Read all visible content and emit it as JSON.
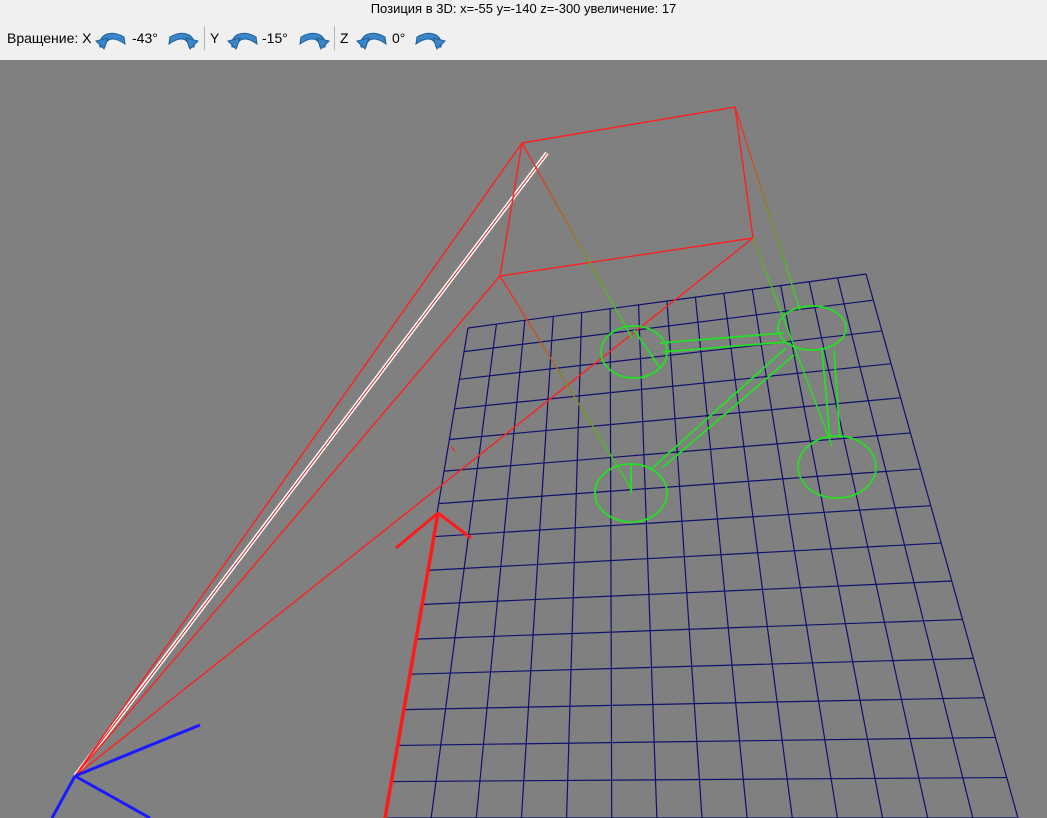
{
  "window": {
    "title": "Позиция в 3D: x=-55 y=-140 z=-300 увеличение: 17"
  },
  "toolbar": {
    "rotation_label": "Вращение: X",
    "x": {
      "axis_label": "X",
      "value": "-43°"
    },
    "y": {
      "axis_label": "Y",
      "value": "-15°"
    },
    "z": {
      "axis_label": "Z",
      "value": "0°"
    },
    "icons": {
      "rotate_left": "rotate-left-icon",
      "rotate_right": "rotate-right-icon"
    }
  },
  "colors": {
    "viewport_background": "#808080",
    "grid": "#10106e",
    "frustum": "#ff2020",
    "model": "#22e022",
    "axis_red": "#ff1a1a",
    "axis_blue": "#1a1aff",
    "ray": "#ffffff",
    "toolbar_background": "#f0f0f0"
  }
}
